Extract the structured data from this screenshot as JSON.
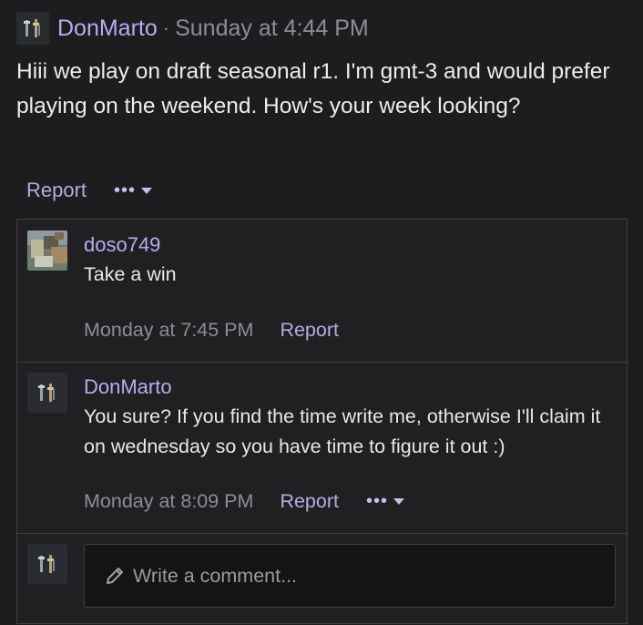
{
  "post": {
    "author": "DonMarto",
    "separator": "·",
    "time": "Sunday at 4:44 PM",
    "body": "Hiii we play on draft seasonal r1. I'm gmt-3 and would prefer playing on the weekend. How's your week looking?",
    "report_label": "Report",
    "more_label": "•••"
  },
  "replies": [
    {
      "author": "doso749",
      "text": "Take a win",
      "time": "Monday at 7:45 PM",
      "report_label": "Report"
    },
    {
      "author": "DonMarto",
      "text": "You sure? If you find the time write me, otherwise I'll claim it on wednesday so you have time to figure it out :)",
      "time": "Monday at 8:09 PM",
      "report_label": "Report",
      "more_label": "•••"
    }
  ],
  "comment": {
    "placeholder": "Write a comment..."
  },
  "colors": {
    "background": "#1d1d1f",
    "accent_name": "#b4aef0",
    "link": "#b2adde",
    "muted": "#8d8d94"
  },
  "icons": {
    "pencil": "pencil-icon",
    "caret": "chevron-down-icon",
    "avatar_figures": "swords-avatar-icon"
  }
}
